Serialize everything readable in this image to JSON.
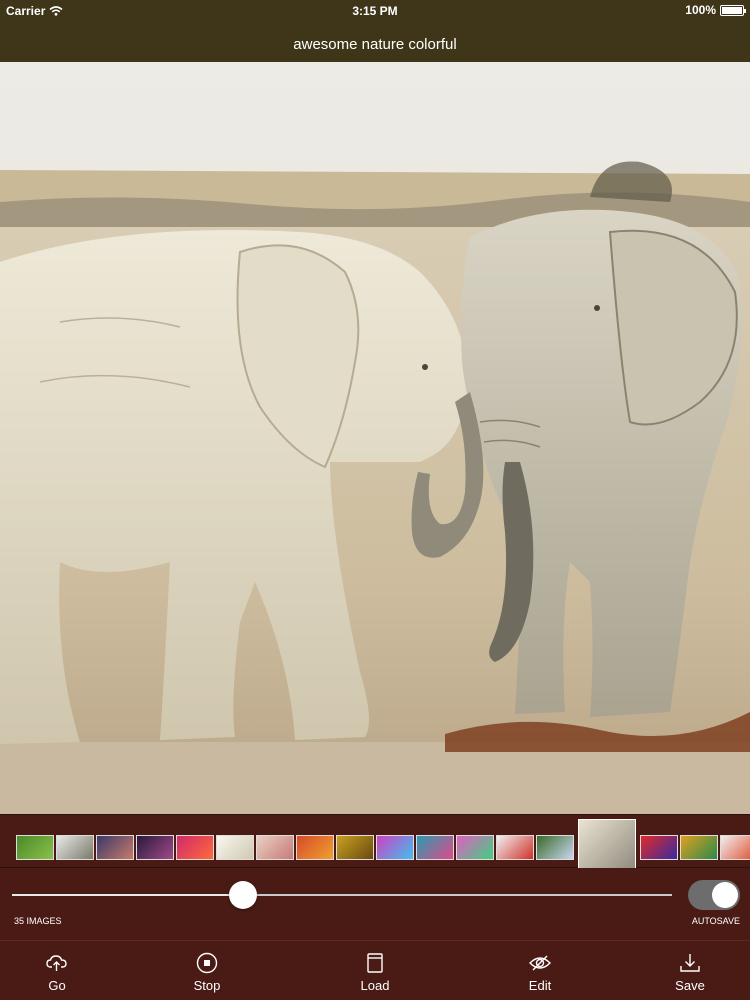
{
  "status_bar": {
    "carrier": "Carrier",
    "time": "3:15 PM",
    "battery": "100%"
  },
  "nav": {
    "title": "awesome nature colorful"
  },
  "gallery": {
    "thumbnails": [
      {
        "colors": [
          "#4a8a2a",
          "#8cc04a"
        ]
      },
      {
        "colors": [
          "#e8e8e8",
          "#7a7a6a"
        ]
      },
      {
        "colors": [
          "#3a3a6a",
          "#c87a6a"
        ]
      },
      {
        "colors": [
          "#2a1a3a",
          "#a04a8a"
        ]
      },
      {
        "colors": [
          "#d02a6a",
          "#ff6a3a"
        ]
      },
      {
        "colors": [
          "#f8f8f0",
          "#d0c8b0"
        ]
      },
      {
        "colors": [
          "#e8d0c0",
          "#c87a7a"
        ]
      },
      {
        "colors": [
          "#d84a2a",
          "#f0a030"
        ]
      },
      {
        "colors": [
          "#c8a020",
          "#6a4a10"
        ]
      },
      {
        "colors": [
          "#d040c0",
          "#40c0f0"
        ]
      },
      {
        "colors": [
          "#2a9ab0",
          "#e04a8a"
        ]
      },
      {
        "colors": [
          "#e060c0",
          "#40d080"
        ]
      },
      {
        "colors": [
          "#f0f0f0",
          "#d0302a"
        ]
      },
      {
        "colors": [
          "#3a6a2a",
          "#c8d8f0"
        ]
      },
      {
        "colors": [
          "#eae3d2",
          "#8a8678"
        ]
      },
      {
        "colors": [
          "#e02a2a",
          "#3a2aa0"
        ]
      },
      {
        "colors": [
          "#e0a020",
          "#2a8a4a"
        ]
      },
      {
        "colors": [
          "#f0f0f0",
          "#e04a2a"
        ]
      }
    ],
    "selected_index": 14
  },
  "controls": {
    "slider_value": 0.35,
    "images_count": "35 IMAGES",
    "autosave_label": "AUTOSAVE",
    "autosave_on": true
  },
  "toolbar": {
    "go": "Go",
    "stop": "Stop",
    "load": "Load",
    "edit": "Edit",
    "save": "Save"
  },
  "colors": {
    "bar_bg": "#3f3619",
    "panel_bg": "#4a1b15"
  }
}
